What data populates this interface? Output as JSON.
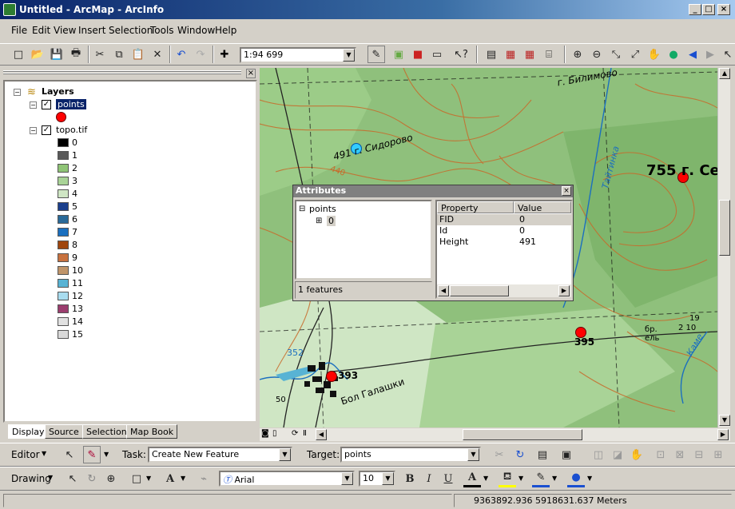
{
  "window": {
    "title": "Untitled - ArcMap - ArcInfo",
    "controls": [
      "_",
      "□",
      "×"
    ]
  },
  "menu": [
    "File",
    "Edit",
    "View",
    "Insert",
    "Selection",
    "Tools",
    "Window",
    "Help"
  ],
  "standard_toolbar": {
    "scale": "1:94 699"
  },
  "toc": {
    "root_label": "Layers",
    "layers": [
      {
        "name": "points",
        "checked": true
      },
      {
        "name": "topo.tif",
        "checked": true
      }
    ],
    "raster_classes": [
      {
        "label": "0",
        "color": "#000000"
      },
      {
        "label": "1",
        "color": "#595959"
      },
      {
        "label": "2",
        "color": "#8fc476"
      },
      {
        "label": "3",
        "color": "#a9d397"
      },
      {
        "label": "4",
        "color": "#cfe6c4"
      },
      {
        "label": "5",
        "color": "#1b3f8c"
      },
      {
        "label": "6",
        "color": "#2a6a99"
      },
      {
        "label": "7",
        "color": "#1a6fbf"
      },
      {
        "label": "8",
        "color": "#a0460e"
      },
      {
        "label": "9",
        "color": "#c8723f"
      },
      {
        "label": "10",
        "color": "#c0956a"
      },
      {
        "label": "11",
        "color": "#58b3d4"
      },
      {
        "label": "12",
        "color": "#a8dcef"
      },
      {
        "label": "13",
        "color": "#9b3d6e"
      },
      {
        "label": "14",
        "color": "#e1e1e1"
      },
      {
        "label": "15",
        "color": "#d9d9d9"
      }
    ],
    "tabs": [
      "Display",
      "Source",
      "Selection",
      "Map Book"
    ]
  },
  "map": {
    "labels": {
      "sidorovo": "491 г. Сидорово",
      "biliimovo": "г. Билимово",
      "peak755": "755 г. Се",
      "p395": "395",
      "p393": "393",
      "village": "Бол Галашки",
      "h352": "352",
      "h440": "440",
      "river": "Тайтинка",
      "kam": "Каме",
      "elev19": "19",
      "elev2": "2 10",
      "bel": "бр. ель",
      "scale50": "50"
    }
  },
  "attributes": {
    "title": "Attributes",
    "tree_root": "points",
    "tree_child": "0",
    "feature_count": "1 features",
    "columns": [
      "Property",
      "Value"
    ],
    "rows": [
      {
        "property": "FID",
        "value": "0"
      },
      {
        "property": "Id",
        "value": "0"
      },
      {
        "property": "Height",
        "value": "491"
      }
    ]
  },
  "editor_toolbar": {
    "editor_label": "Editor",
    "task_label": "Task:",
    "task_value": "Create New Feature",
    "target_label": "Target:",
    "target_value": "points"
  },
  "drawing_toolbar": {
    "drawing_label": "Drawing",
    "font": "Arial",
    "size": "10",
    "bold": "B",
    "italic": "I",
    "underline": "U",
    "font_color_glyph": "A"
  },
  "status": {
    "coordinates": "9363892.936  5918631.637 Meters"
  },
  "colors": {
    "point_red": "#ff0000",
    "point_selected": "#33ccff",
    "map_green": "#8fbf7f",
    "title_blue": "#0a246a"
  }
}
